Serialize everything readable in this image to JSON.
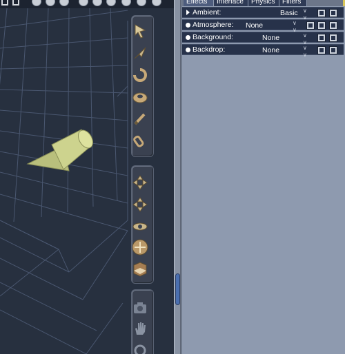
{
  "tabs": [
    {
      "label": "Effects",
      "active": true
    },
    {
      "label": "Interface",
      "active": false
    },
    {
      "label": "Physics",
      "active": false
    },
    {
      "label": "Filters",
      "active": false
    }
  ],
  "effects": [
    {
      "label": "Ambient:",
      "value": "Basic",
      "marker": "triangle"
    },
    {
      "label": "Atmosphere:",
      "value": "None",
      "marker": "dot"
    },
    {
      "label": "Background:",
      "value": "None",
      "marker": "dot"
    },
    {
      "label": "Backdrop:",
      "value": "None",
      "marker": "dot"
    }
  ],
  "toolbar": {
    "group1": [
      "arrow-select-icon",
      "direction-arrow-icon",
      "rotate-icon",
      "torus-icon",
      "brush-icon",
      "clip-icon"
    ],
    "group2": [
      "move-xz-icon",
      "move-xy-icon",
      "move-yz-icon",
      "universal-move-icon",
      "cube-scale-icon"
    ],
    "group3": [
      "camera-icon",
      "hand-icon",
      "ring-icon"
    ]
  },
  "colors": {
    "viewport_bg": "#27303f",
    "grid_line": "#4a5770",
    "panel_bg": "#8e9aaf",
    "row_bg": "#27324a",
    "object": "#c9cf8a"
  }
}
